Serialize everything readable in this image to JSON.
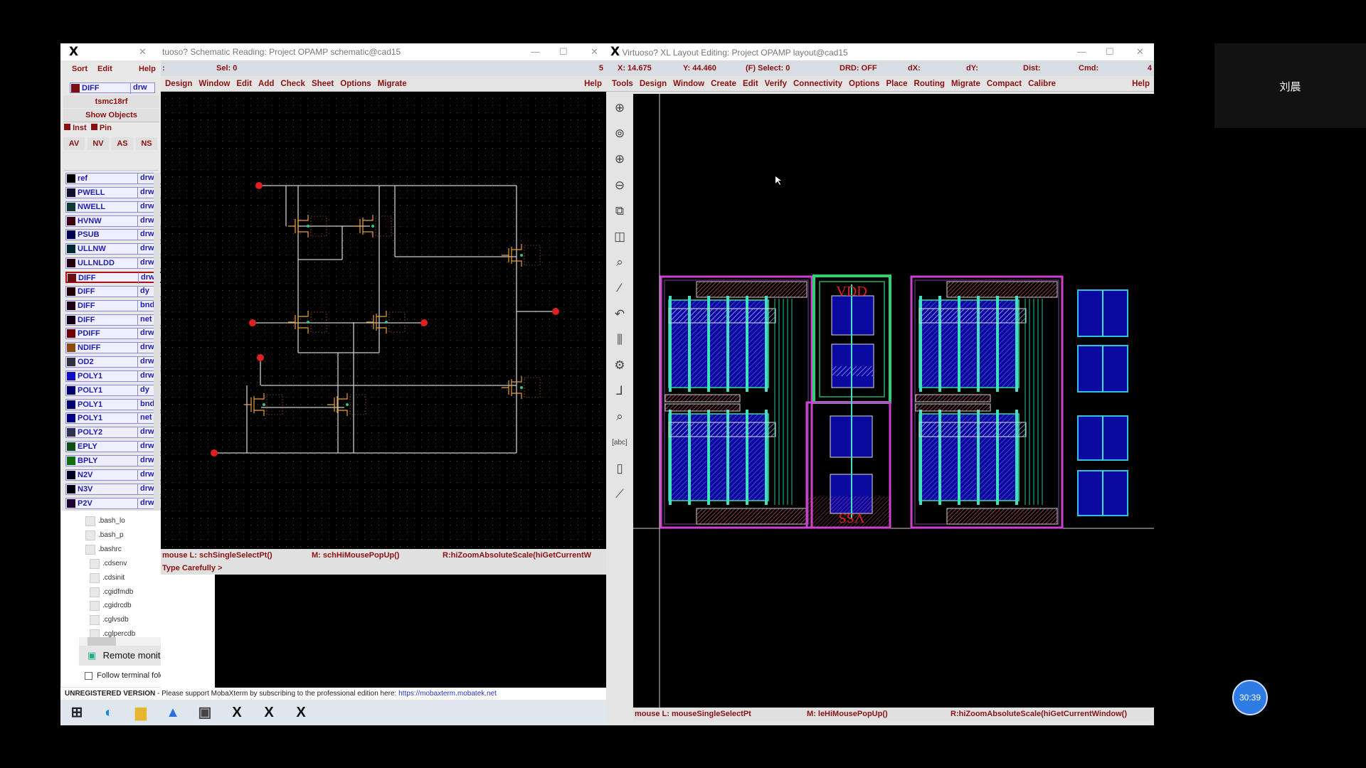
{
  "palette": {
    "menu": [
      "Sort",
      "Edit",
      "Help"
    ],
    "current_layer": {
      "name": "DIFF",
      "purpose": "drw",
      "color": "#7a1010"
    },
    "tech": "tsmc18rf",
    "show_objects": "Show Objects",
    "inst": "Inst",
    "pin": "Pin",
    "buttons": [
      "AV",
      "NV",
      "AS",
      "NS"
    ],
    "layers": [
      {
        "name": "ref",
        "purpose": "drw",
        "color": "#000000"
      },
      {
        "name": "PWELL",
        "purpose": "drw",
        "color": "#101030"
      },
      {
        "name": "NWELL",
        "purpose": "drw",
        "color": "#0f3a3a"
      },
      {
        "name": "HVNW",
        "purpose": "drw",
        "color": "#3a0010"
      },
      {
        "name": "PSUB",
        "purpose": "drw",
        "color": "#000050"
      },
      {
        "name": "ULLNW",
        "purpose": "drw",
        "color": "#002830"
      },
      {
        "name": "ULLNLDD",
        "purpose": "drw",
        "color": "#200010"
      },
      {
        "name": "DIFF",
        "purpose": "drw",
        "color": "#6a1010",
        "selected": true
      },
      {
        "name": "DIFF",
        "purpose": "dy",
        "color": "#200000"
      },
      {
        "name": "DIFF",
        "purpose": "bnd",
        "color": "#200010"
      },
      {
        "name": "DIFF",
        "purpose": "net",
        "color": "#100010"
      },
      {
        "name": "PDIFF",
        "purpose": "drw",
        "color": "#700000"
      },
      {
        "name": "NDIFF",
        "purpose": "drw",
        "color": "#8a4a10"
      },
      {
        "name": "OD2",
        "purpose": "drw",
        "color": "#303040"
      },
      {
        "name": "POLY1",
        "purpose": "drw",
        "color": "#1010c0"
      },
      {
        "name": "POLY1",
        "purpose": "dy",
        "color": "#000070"
      },
      {
        "name": "POLY1",
        "purpose": "bnd",
        "color": "#000070"
      },
      {
        "name": "POLY1",
        "purpose": "net",
        "color": "#000080"
      },
      {
        "name": "POLY2",
        "purpose": "drw",
        "color": "#303050"
      },
      {
        "name": "EPLY",
        "purpose": "drw",
        "color": "#105010"
      },
      {
        "name": "BPLY",
        "purpose": "drw",
        "color": "#107010"
      },
      {
        "name": "N2V",
        "purpose": "drw",
        "color": "#000020"
      },
      {
        "name": "N3V",
        "purpose": "drw",
        "color": "#000010"
      },
      {
        "name": "P2V",
        "purpose": "drw",
        "color": "#200030"
      }
    ]
  },
  "schematic": {
    "title": "tuoso? Schematic Reading: Project OPAMP schematic@cad15",
    "status_sel": "Sel: 0",
    "status_num": "5",
    "status_colon": ":",
    "menu": [
      "Design",
      "Window",
      "Edit",
      "Add",
      "Check",
      "Sheet",
      "Options",
      "Migrate"
    ],
    "help": "Help",
    "mouse_l": "mouse L: schSingleSelectPt()",
    "mouse_m": "M: schHiMousePopUp()",
    "mouse_r": "R:hiZoomAbsoluteScale(hiGetCurrentW",
    "prompt": "Type Carefully >"
  },
  "layout": {
    "title": "Virtuoso? XL Layout Editing: Project OPAMP layout@cad15",
    "x": "X: 14.675",
    "y": "Y: 44.460",
    "select": "(F) Select: 0",
    "drd": "DRD: OFF",
    "dx": "dX:",
    "dy": "dY:",
    "dist": "Dist:",
    "cmd": "Cmd:",
    "num": "4",
    "menu": [
      "Tools",
      "Design",
      "Window",
      "Create",
      "Edit",
      "Verify",
      "Connectivity",
      "Options",
      "Place",
      "Routing",
      "Migrate",
      "Compact",
      "Calibre"
    ],
    "help": "Help",
    "mouse_l": "mouse L: mouseSingleSelectPt",
    "mouse_m": "M: leHiMousePopUp()",
    "mouse_r": "R:hiZoomAbsoluteScale(hiGetCurrentWindow()",
    "vdd": "VDD",
    "vss": "VSS",
    "tools": [
      "stop-icon",
      "fit-icon",
      "zoom-in-icon",
      "zoom-out-icon",
      "pan-icon",
      "split-icon",
      "magnify-icon",
      "path-icon",
      "undo-icon",
      "pins-icon",
      "hierarchy-icon",
      "wire-icon",
      "select-icon",
      "label-icon",
      "ruler-box-icon",
      "ruler-icon"
    ]
  },
  "mobaxterm": {
    "files": [
      ".bash_lo",
      ".bash_p",
      ".bashrc",
      ".cdsenv",
      ".cdsinit",
      ".cgidfmdb",
      ".cgidrcdb",
      ".cglvsdb",
      ".cglpercdb"
    ],
    "remote_monitoring": "Remote monitoring",
    "follow_folder": "Follow terminal folder",
    "banner": "UNREGISTERED VERSION",
    "banner_text": "-  Please support MobaXterm by subscribing to the professional edition here:",
    "banner_link": "https://mobaxterm.mobatek.net"
  },
  "taskbar": {
    "apps": [
      "windows-start-icon",
      "edge-icon",
      "file-explorer-icon",
      "mobaxterm-icon",
      "terminal-icon",
      "x-server-icon",
      "x-server-icon",
      "x-server-icon"
    ]
  },
  "overlay": {
    "user_name": "刘晨",
    "timer": "30:39"
  }
}
